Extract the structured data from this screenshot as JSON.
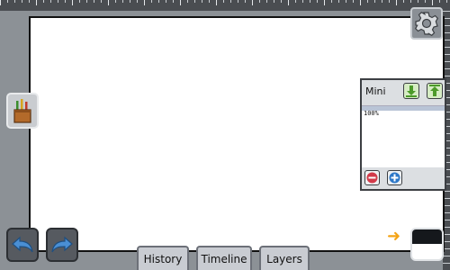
{
  "app": {
    "canvas_color": "#ffffff",
    "workspace_color": "#8c9196",
    "accent_arrow_color": "#f4a417"
  },
  "toolbar": {
    "settings_icon": "gear-icon",
    "tool_icon": "brush-cup-icon"
  },
  "mini_panel": {
    "title": "Mini",
    "zoom": "100%",
    "download_icon": "download-icon",
    "upload_icon": "upload-icon",
    "zoom_out_icon": "minus-icon",
    "zoom_in_icon": "plus-icon"
  },
  "nav": {
    "undo_icon": "undo-icon",
    "redo_icon": "redo-icon"
  },
  "tabs": [
    {
      "label": "History"
    },
    {
      "label": "Timeline"
    },
    {
      "label": "Layers"
    }
  ],
  "color_swatch": {
    "primary": "#15181c",
    "secondary": "#ffffff"
  }
}
